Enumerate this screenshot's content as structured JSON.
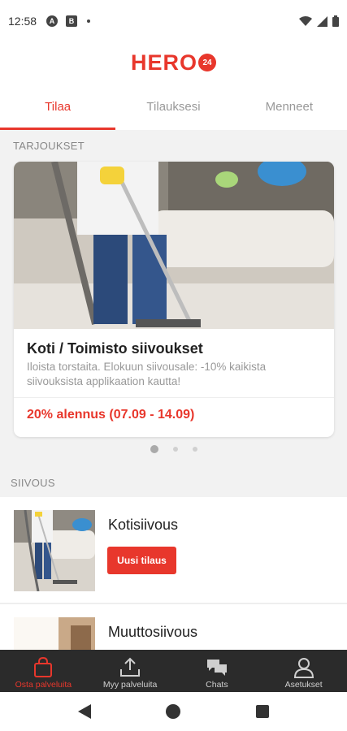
{
  "status_bar": {
    "time": "12:58",
    "icon_a": "A",
    "icon_b": "B"
  },
  "brand": {
    "name": "HERO",
    "badge": "24",
    "accent_color": "#e8372c"
  },
  "tabs": [
    {
      "label": "Tilaa",
      "active": true
    },
    {
      "label": "Tilauksesi",
      "active": false
    },
    {
      "label": "Menneet",
      "active": false
    }
  ],
  "offers": {
    "section_title": "TARJOUKSET",
    "card": {
      "title": "Koti / Toimisto siivoukset",
      "description": "Iloista torstaita. Elokuun siivousale: -10% kaikista siivouksista applikaation kautta!",
      "price_label": "20% alennus (07.09 - 14.09)"
    },
    "carousel_page": 1,
    "carousel_total": 3
  },
  "services": {
    "section_title": "SIIVOUS",
    "items": [
      {
        "name": "Kotisiivous",
        "button": "Uusi tilaus"
      },
      {
        "name": "Muuttosiivous"
      }
    ]
  },
  "bottom_nav": [
    {
      "label": "Osta palveluita",
      "icon": "shopping-bag-icon",
      "active": true
    },
    {
      "label": "Myy palveluita",
      "icon": "upload-icon",
      "active": false
    },
    {
      "label": "Chats",
      "icon": "chat-icon",
      "active": false
    },
    {
      "label": "Asetukset",
      "icon": "user-icon",
      "active": false
    }
  ]
}
